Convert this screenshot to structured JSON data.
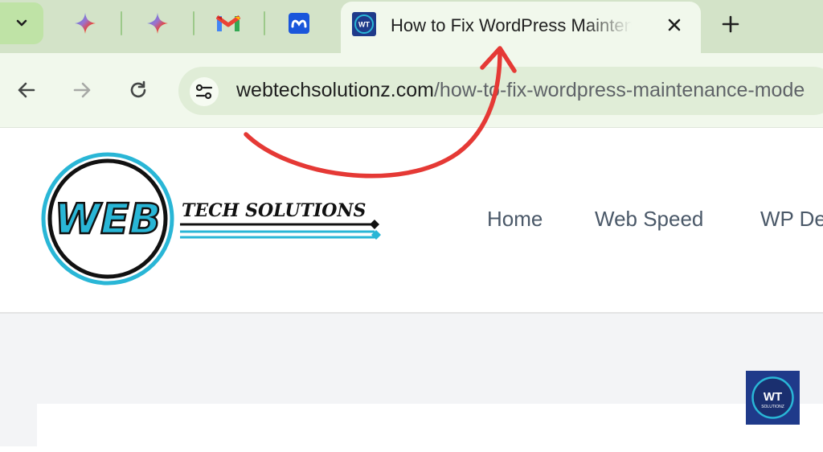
{
  "browser": {
    "tab_search_icon": "chevron-down-icon",
    "pinned_tabs": [
      {
        "icon": "gemini-sparkle-icon"
      },
      {
        "icon": "gemini-sparkle-icon"
      },
      {
        "icon": "gmail-icon"
      },
      {
        "icon": "meta-icon"
      }
    ],
    "active_tab": {
      "title": "How to Fix WordPress Maintenance Mode",
      "favicon_text": "WT",
      "close_icon": "close-icon"
    },
    "new_tab_icon": "plus-icon",
    "toolbar": {
      "back_icon": "arrow-left-icon",
      "forward_icon": "arrow-right-icon",
      "reload_icon": "reload-icon",
      "site_info_icon": "tune-icon",
      "url_domain": "webtechsolutionz.com",
      "url_path": "/how-to-fix-wordpress-maintenance-mode"
    }
  },
  "site": {
    "logo_word": "WEB",
    "logo_tagline": "TECH SOLUTIONS",
    "nav": [
      "Home",
      "Web Speed",
      "WP De"
    ],
    "badge": {
      "line1": "WT",
      "line2": "SOLUTIONZ"
    }
  },
  "annotation": {
    "arrow_color": "#e53935",
    "icon": "curved-arrow-annotation"
  },
  "colors": {
    "tabstrip": "#d3e3c8",
    "toolbar": "#f1f8ec",
    "logo_cyan": "#29b6d6",
    "badge_navy": "#1f3a8a"
  }
}
